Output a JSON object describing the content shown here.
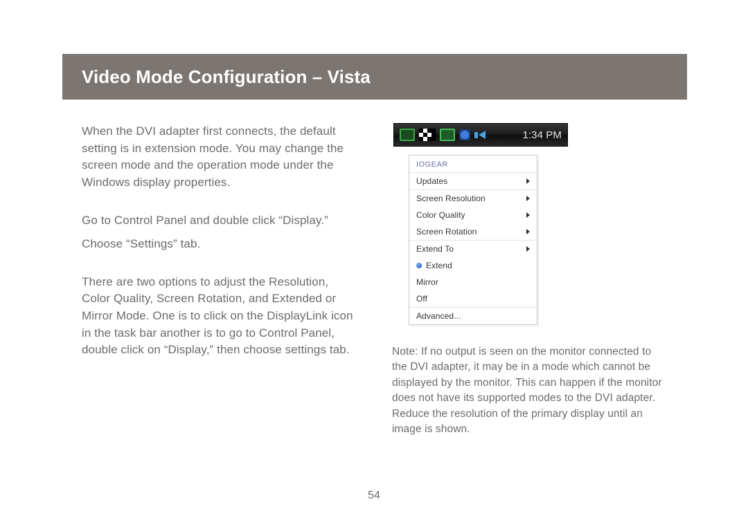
{
  "header": {
    "title": "Video Mode Configuration – Vista"
  },
  "left": {
    "p1": "When the DVI adapter first connects, the default setting is in extension mode. You may change the screen mode and the operation mode under the Windows display properties.",
    "p2": "Go to Control Panel and double click “Display.”",
    "p3": "Choose “Settings” tab.",
    "p4": "There are two options to adjust the Resolution, Color Quality, Screen Rotation, and Extended or Mirror Mode. One is to click on the DisplayLink icon in the task bar another is to go to Control Panel, double click on “Display,” then choose settings tab."
  },
  "taskbar": {
    "time": "1:34 PM"
  },
  "menu": {
    "brand": "IOGEAR",
    "items": [
      {
        "label": "Updates",
        "arrow": true,
        "sep": false,
        "check": false
      },
      {
        "label": "Screen Resolution",
        "arrow": true,
        "sep": true,
        "check": false
      },
      {
        "label": "Color Quality",
        "arrow": true,
        "sep": false,
        "check": false
      },
      {
        "label": "Screen Rotation",
        "arrow": true,
        "sep": false,
        "check": false
      },
      {
        "label": "Extend To",
        "arrow": true,
        "sep": true,
        "check": false
      },
      {
        "label": "Extend",
        "arrow": false,
        "sep": false,
        "check": true
      },
      {
        "label": "Mirror",
        "arrow": false,
        "sep": false,
        "check": false
      },
      {
        "label": "Off",
        "arrow": false,
        "sep": false,
        "check": false
      },
      {
        "label": "Advanced...",
        "arrow": false,
        "sep": true,
        "check": false
      }
    ]
  },
  "note": "Note: If no output is seen on the monitor connected to the DVI adapter, it may be in a mode which cannot be displayed by the monitor. This can happen if the monitor does not have its supported modes to the DVI adapter. Reduce the resolution of the primary display until an image is shown.",
  "page_number": "54"
}
